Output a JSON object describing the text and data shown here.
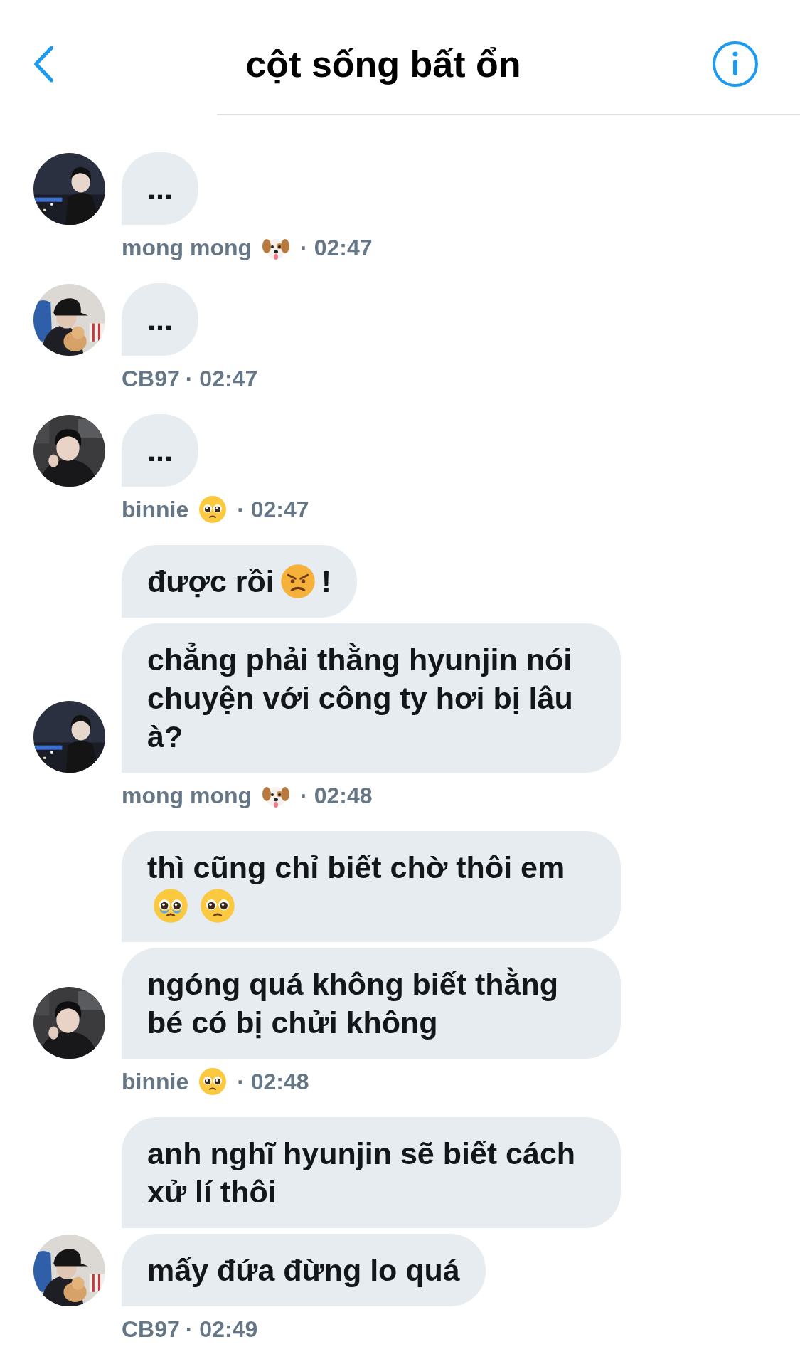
{
  "header": {
    "title": "cột sống bất ổn"
  },
  "groups": [
    {
      "sender": "mong mong",
      "badge": {
        "kind": "dog"
      },
      "time": "· 02:47",
      "avatar": {
        "kind": "picture"
      },
      "bubbles": [
        [
          {
            "kind": "text",
            "text": "..."
          }
        ]
      ]
    },
    {
      "sender": "CB97",
      "time": "· 02:47",
      "avatar": {
        "kind": "picture"
      },
      "bubbles": [
        [
          {
            "kind": "text",
            "text": "..."
          }
        ]
      ]
    },
    {
      "sender": "binnie",
      "badge": {
        "kind": "pleading"
      },
      "time": "· 02:47",
      "avatar": {
        "kind": "picture"
      },
      "bubbles": [
        [
          {
            "kind": "text",
            "text": "..."
          }
        ]
      ]
    },
    {
      "sender": "mong mong",
      "badge": {
        "kind": "dog"
      },
      "time": "· 02:48",
      "avatar": {
        "kind": "picture"
      },
      "bubbles": [
        [
          {
            "kind": "text",
            "text": "được rồi"
          },
          {
            "kind": "angry"
          },
          {
            "kind": "text",
            "text": "!"
          }
        ],
        [
          {
            "kind": "text",
            "text": "chẳng phải thằng hyunjin nói chuyện với công ty hơi bị lâu à?"
          }
        ]
      ]
    },
    {
      "sender": "binnie",
      "badge": {
        "kind": "pleading"
      },
      "time": "· 02:48",
      "avatar": {
        "kind": "picture"
      },
      "bubbles": [
        [
          {
            "kind": "text",
            "text": "thì cũng chỉ biết chờ thôi em"
          },
          {
            "kind": "tearful"
          },
          {
            "kind": "pleading"
          }
        ],
        [
          {
            "kind": "text",
            "text": "ngóng quá không biết thằng bé có bị chửi không"
          }
        ]
      ]
    },
    {
      "sender": "CB97",
      "time": "· 02:49",
      "avatar": {
        "kind": "picture"
      },
      "bubbles": [
        [
          {
            "kind": "text",
            "text": "anh nghĩ hyunjin sẽ biết cách xử lí thôi"
          }
        ],
        [
          {
            "kind": "text",
            "text": "mấy đứa đừng lo quá"
          }
        ]
      ]
    }
  ]
}
